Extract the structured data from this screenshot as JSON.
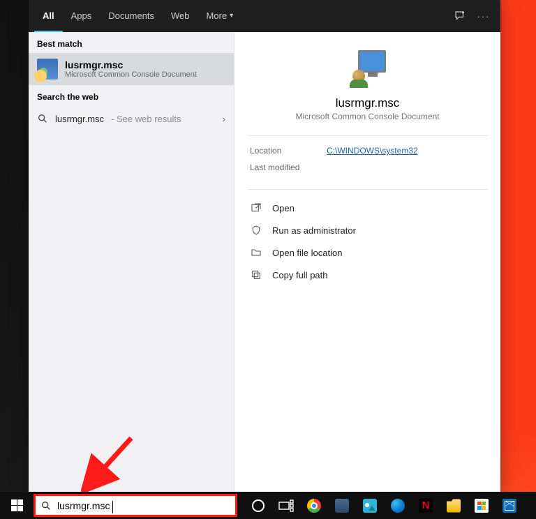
{
  "header": {
    "tabs": [
      {
        "label": "All",
        "active": true
      },
      {
        "label": "Apps"
      },
      {
        "label": "Documents"
      },
      {
        "label": "Web"
      },
      {
        "label": "More",
        "hasDropdown": true
      }
    ]
  },
  "left": {
    "best_match_heading": "Best match",
    "best_match": {
      "title": "lusrmgr.msc",
      "subtitle": "Microsoft Common Console Document"
    },
    "search_web_heading": "Search the web",
    "web_result": {
      "query": "lusrmgr.msc",
      "hint": " - See web results"
    }
  },
  "preview": {
    "title": "lusrmgr.msc",
    "subtitle": "Microsoft Common Console Document",
    "meta": {
      "location_label": "Location",
      "location_value": "C:\\WINDOWS\\system32",
      "last_modified_label": "Last modified"
    },
    "actions": {
      "open": "Open",
      "run_admin": "Run as administrator",
      "open_location": "Open file location",
      "copy_path": "Copy full path"
    }
  },
  "searchbox": {
    "value": "lusrmgr.msc"
  },
  "taskbar": {
    "icons": [
      "cortana",
      "task-view",
      "chrome",
      "acrobat",
      "photos",
      "edge",
      "netflix",
      "explorer",
      "store",
      "mail"
    ]
  }
}
